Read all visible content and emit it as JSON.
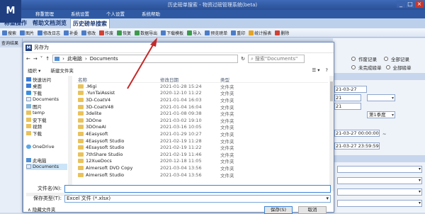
{
  "app": {
    "logo_text": "M",
    "title": "历史磅单搜索 - 物资过磅管理系统(beta)",
    "window_buttons": [
      "_",
      "□",
      "×"
    ],
    "menu": [
      "称重管理",
      "系统设置",
      "个人设置",
      "系统帮助"
    ],
    "tabs": [
      "称重操作",
      "帮助文档浏览",
      "历史磅单搜索"
    ],
    "active_tab": 2,
    "toolbar": [
      {
        "label": "搜索",
        "icon": "search-icon"
      },
      {
        "label": "图片",
        "icon": "image-icon"
      },
      {
        "label": "修改日志",
        "icon": "log-icon"
      },
      {
        "label": "补委",
        "icon": "add-icon"
      },
      {
        "label": "修改",
        "icon": "edit-icon"
      },
      {
        "label": "作废",
        "icon": "void-icon"
      },
      {
        "label": "恢复",
        "icon": "restore-icon"
      },
      {
        "label": "数据导出",
        "icon": "export-icon"
      },
      {
        "label": "下载模板",
        "icon": "download-icon"
      },
      {
        "label": "导入",
        "icon": "import-icon"
      },
      {
        "label": "预览磅单",
        "icon": "preview-icon"
      },
      {
        "label": "重印",
        "icon": "print-icon"
      },
      {
        "label": "统计报表",
        "icon": "report-icon"
      },
      {
        "label": "删除",
        "icon": "delete-icon"
      }
    ],
    "left_pane_label": "查询结果",
    "right_panel": {
      "radios_row1": [
        "作废记录",
        "全部记录"
      ],
      "radios_row2": [
        "未完成磅单",
        "全部磅单"
      ],
      "date1": "21-03-27",
      "value1": "21",
      "value2": "21",
      "quarter": "第1季度",
      "datetime_start": "21-03-27 00:00:00",
      "tilde": "~",
      "datetime_end": "21-03-27 23:59:59"
    }
  },
  "dialog": {
    "title": "另存为",
    "logo_text": "M",
    "address": [
      "此电脑",
      "Documents"
    ],
    "search_placeholder": "搜索\"Documents\"",
    "toolbar": {
      "organize": "组织 ▾",
      "new_folder": "新建文件夹"
    },
    "nav": [
      {
        "label": "快速访问",
        "icon": "star-icon",
        "cls": "blue"
      },
      {
        "label": "桌面",
        "icon": "desktop-icon",
        "cls": "blue"
      },
      {
        "label": "下载",
        "icon": "download-icon",
        "cls": "dl"
      },
      {
        "label": "Documents",
        "icon": "document-icon",
        "cls": "doc"
      },
      {
        "label": "图片",
        "icon": "picture-icon",
        "cls": "pic"
      },
      {
        "label": "temp",
        "icon": "folder-icon",
        "cls": "folder"
      },
      {
        "label": "安下载",
        "icon": "folder-icon",
        "cls": "folder"
      },
      {
        "label": "视频",
        "icon": "folder-icon",
        "cls": "folder"
      },
      {
        "label": "下载",
        "icon": "folder-icon",
        "cls": "folder"
      },
      {
        "label": "",
        "icon": "",
        "cls": ""
      },
      {
        "label": "OneDrive",
        "icon": "onedrive-icon",
        "cls": "cloud"
      },
      {
        "label": "",
        "icon": "",
        "cls": ""
      },
      {
        "label": "此电脑",
        "icon": "computer-icon",
        "cls": "pc"
      },
      {
        "label": "Documents",
        "icon": "document-icon",
        "cls": "doc",
        "selected": true
      }
    ],
    "columns": [
      "名称",
      "修改日期",
      "类型"
    ],
    "files": [
      {
        "name": ".Migi",
        "date": "2021-01-28 15:24",
        "type": "文件夹"
      },
      {
        "name": ".YunTaiAssist",
        "date": "2020-12-10 11:22",
        "type": "文件夹"
      },
      {
        "name": "3D-CoatV4",
        "date": "2021-01-04 16:03",
        "type": "文件夹"
      },
      {
        "name": "3D-CoatV48",
        "date": "2021-01-04 16:04",
        "type": "文件夹"
      },
      {
        "name": "3delite",
        "date": "2021-01-08 09:38",
        "type": "文件夹"
      },
      {
        "name": "3DOne",
        "date": "2021-03-02 19:10",
        "type": "文件夹"
      },
      {
        "name": "3DOneAI",
        "date": "2021-03-16 10:05",
        "type": "文件夹"
      },
      {
        "name": "4Easysoft",
        "date": "2021-01-29 10:27",
        "type": "文件夹"
      },
      {
        "name": "4Easysoft Studio",
        "date": "2021-02-19 11:28",
        "type": "文件夹"
      },
      {
        "name": "4Esaysoft Studio",
        "date": "2021-02-19 11:22",
        "type": "文件夹"
      },
      {
        "name": "7thShare Studio",
        "date": "2021-02-19 11:46",
        "type": "文件夹"
      },
      {
        "name": "12XueDocs",
        "date": "2020-12-18 11:05",
        "type": "文件夹"
      },
      {
        "name": "Aimersoft DVD Copy",
        "date": "2021-03-04 13:56",
        "type": "文件夹"
      },
      {
        "name": "Aimersoft Studio",
        "date": "2021-03-04 13:56",
        "type": "文件夹"
      }
    ],
    "filename_label": "文件名(N):",
    "filename_value": "",
    "filetype_label": "保存类型(T):",
    "filetype_value": "Excel 文件 (*.xlsx)",
    "hide_folders": "隐藏文件夹",
    "save_label": "保存(S)",
    "cancel_label": "取消"
  },
  "annotation_color": "#c62828"
}
